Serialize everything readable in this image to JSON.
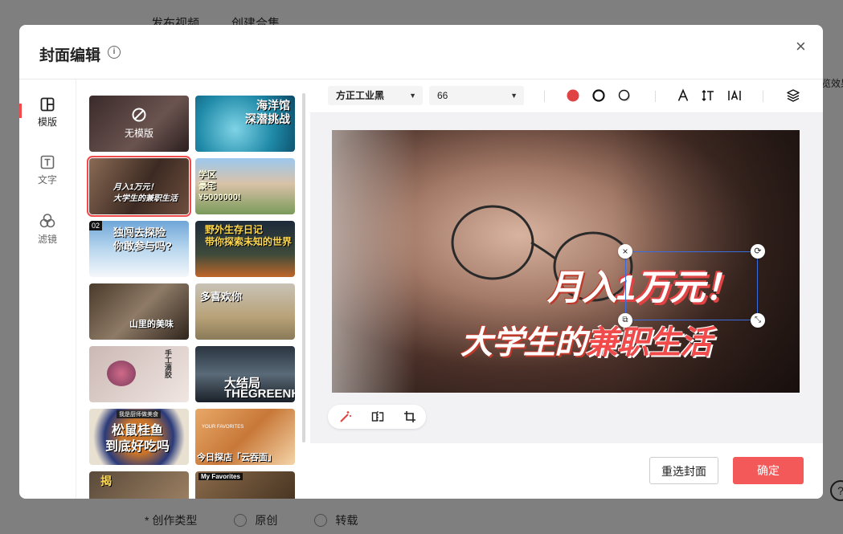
{
  "background": {
    "tabs": [
      "发布视频",
      "创建合集"
    ],
    "right_label": "览效果",
    "bottom": {
      "label": "* 创作类型",
      "options": [
        "原创",
        "转载"
      ]
    },
    "help_symbol": "?"
  },
  "modal": {
    "title": "封面编辑",
    "close_symbol": "×",
    "nav": [
      {
        "label": "模版",
        "icon": "layout-icon"
      },
      {
        "label": "文字",
        "icon": "text-icon"
      },
      {
        "label": "滤镜",
        "icon": "filter-icon"
      }
    ],
    "templates": [
      {
        "text": "无模版"
      },
      {
        "text": "海洋馆\n深潜挑战"
      },
      {
        "text": "月入1万元！\n大学生的兼职生活"
      },
      {
        "text": "学区\n豪宅\n¥5000000!"
      },
      {
        "text": "独闯去探险\n你敢参与吗?",
        "badge": "02"
      },
      {
        "text": "野外生存日记\n带你探索未知的世界"
      },
      {
        "text": "山里的美味"
      },
      {
        "text": "多喜欢你"
      },
      {
        "text": "手工滴胶"
      },
      {
        "text": "大结局\nTHEGREENHELL"
      },
      {
        "text": "松鼠桂鱼\n到底好吃吗",
        "badge": "我是厨师做美食"
      },
      {
        "text": "今日探店「云吞面」",
        "badge": "YOUR FAVORITES"
      },
      {
        "text": "揭"
      },
      {
        "text": "My Favorites"
      }
    ],
    "toolbar": {
      "font": "方正工业黑",
      "size": "66",
      "text_color": "#e04343"
    },
    "cover": {
      "line1_white": "月入",
      "line1_red": "1万元！",
      "line2_white": "大学生的",
      "line2_red": "兼职生活"
    },
    "footer": {
      "reselect": "重选封面",
      "confirm": "确定"
    }
  }
}
